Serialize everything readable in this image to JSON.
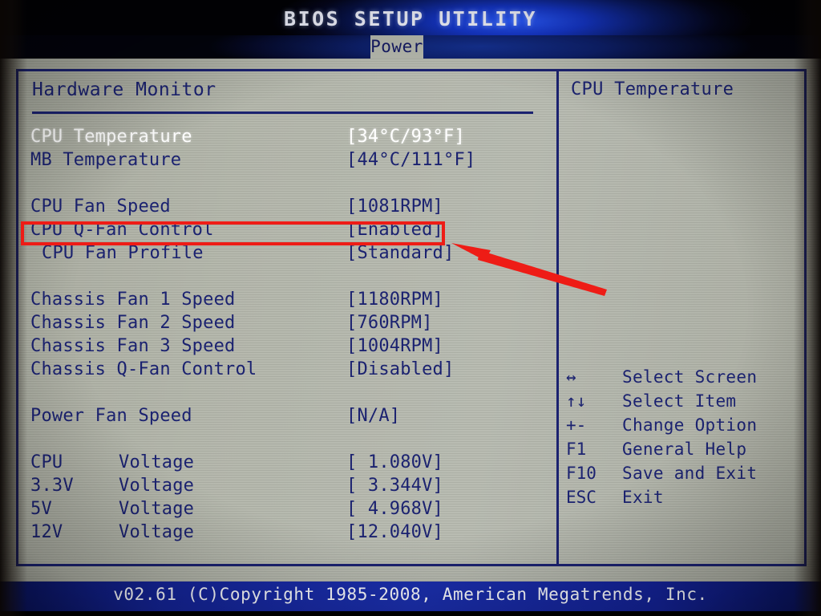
{
  "header": {
    "title": "BIOS SETUP UTILITY",
    "active_tab": "Power"
  },
  "main": {
    "section_title": "Hardware Monitor",
    "rows": [
      {
        "label": "CPU Temperature",
        "value": "[34°C/93°F]",
        "selected": true
      },
      {
        "label": "MB Temperature",
        "value": "[44°C/111°F]",
        "selected": false
      },
      {
        "gap": true
      },
      {
        "label": "CPU Fan Speed",
        "value": "[1081RPM]",
        "selected": false
      },
      {
        "label": "CPU Q-Fan Control",
        "value": "[Enabled]",
        "selected": false
      },
      {
        "label": "CPU Fan Profile",
        "value": "[Standard]",
        "selected": false,
        "indent": true
      },
      {
        "gap": true
      },
      {
        "label": "Chassis Fan 1 Speed",
        "value": "[1180RPM]",
        "selected": false
      },
      {
        "label": "Chassis Fan 2 Speed",
        "value": "[760RPM]",
        "selected": false
      },
      {
        "label": "Chassis Fan 3 Speed",
        "value": "[1004RPM]",
        "selected": false
      },
      {
        "label": "Chassis Q-Fan Control",
        "value": "[Disabled]",
        "selected": false
      },
      {
        "gap": true
      },
      {
        "label": "Power Fan Speed",
        "value": "[N/A]",
        "selected": false
      },
      {
        "gap": true
      },
      {
        "label": "CPU",
        "label2": "Voltage",
        "value": "[ 1.080V]",
        "selected": false
      },
      {
        "label": "3.3V",
        "label2": "Voltage",
        "value": "[ 3.344V]",
        "selected": false
      },
      {
        "label": "5V",
        "label2": "Voltage",
        "value": "[ 4.968V]",
        "selected": false
      },
      {
        "label": "12V",
        "label2": "Voltage",
        "value": "[12.040V]",
        "selected": false
      }
    ]
  },
  "help": {
    "title": "CPU Temperature",
    "legend": [
      {
        "key": "↔",
        "desc": "Select Screen"
      },
      {
        "key": "↑↓",
        "desc": "Select Item"
      },
      {
        "key": "+-",
        "desc": "Change Option"
      },
      {
        "key": "F1",
        "desc": "General Help"
      },
      {
        "key": "F10",
        "desc": "Save and Exit"
      },
      {
        "key": "ESC",
        "desc": "Exit"
      }
    ]
  },
  "footer": {
    "text": "v02.61 (C)Copyright 1985-2008, American Megatrends, Inc."
  },
  "annotations": {
    "highlight_color": "#ee1c16",
    "highlighted_row_label": "CPU Q-Fan Control",
    "highlighted_row_value": "[Enabled]"
  },
  "colors": {
    "text_blue": "#1b2270",
    "selected_text": "#ffffff",
    "background_gray": "#b3b6aa",
    "title_blue": "#1b2fae",
    "annotation_red": "#ee1c16"
  }
}
